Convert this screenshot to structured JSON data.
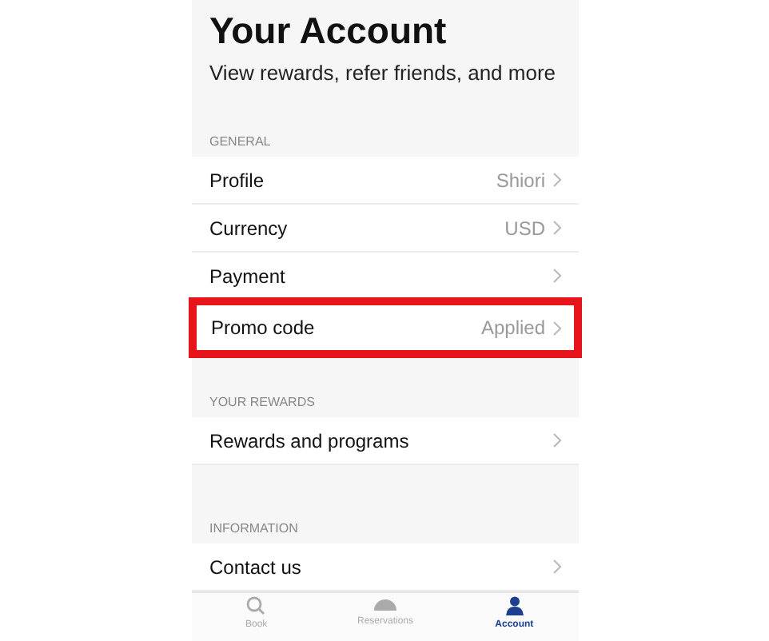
{
  "header": {
    "title": "Your Account",
    "subtitle": "View rewards, refer friends, and more"
  },
  "sections": [
    {
      "title": "GENERAL",
      "rows": [
        {
          "label": "Profile",
          "value": "Shiori",
          "highlighted": false
        },
        {
          "label": "Currency",
          "value": "USD",
          "highlighted": false
        },
        {
          "label": "Payment",
          "highlighted": false
        },
        {
          "label": "Promo code",
          "value": "Applied",
          "highlighted": true
        }
      ]
    },
    {
      "title": "YOUR REWARDS",
      "rows": [
        {
          "label": "Rewards and programs",
          "highlighted": false
        }
      ]
    },
    {
      "title": "INFORMATION",
      "rows": [
        {
          "label": "Contact us",
          "highlighted": false
        }
      ]
    }
  ],
  "tab_bar": [
    {
      "label": "Book",
      "kind": "search",
      "selected": false
    },
    {
      "label": "Reservations",
      "kind": "cloche",
      "selected": false
    },
    {
      "label": "Account",
      "kind": "person",
      "selected": true
    }
  ]
}
